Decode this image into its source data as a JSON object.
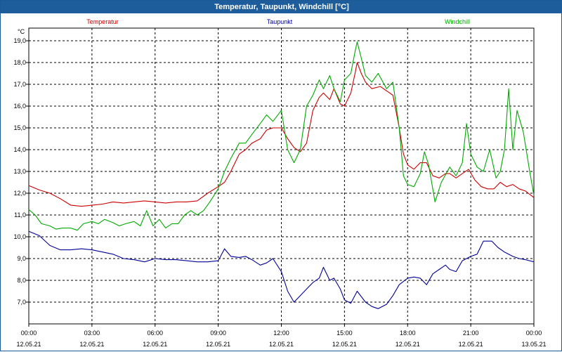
{
  "window": {
    "title": "Temperatur, Taupunkt, Windchill [°C]"
  },
  "chart_data": {
    "type": "line",
    "title": "Temperatur, Taupunkt, Windchill [°C]",
    "ylabel": "°C",
    "xlabel": "",
    "ylim": [
      6.2,
      19.5
    ],
    "xlim": [
      0,
      24
    ],
    "yticks": [
      7.0,
      8.0,
      9.0,
      10.0,
      11.0,
      12.0,
      13.0,
      14.0,
      15.0,
      16.0,
      17.0,
      18.0,
      19.0
    ],
    "ytick_labels": [
      "7,0",
      "8,0",
      "9,0",
      "10,0",
      "11,0",
      "12,0",
      "13,0",
      "14,0",
      "15,0",
      "16,0",
      "17,0",
      "18,0",
      "19,0"
    ],
    "xticks": [
      0,
      3,
      6,
      9,
      12,
      15,
      18,
      21,
      24
    ],
    "xtick_labels": [
      {
        "time": "00:00",
        "date": "12.05.21"
      },
      {
        "time": "03:00",
        "date": "12.05.21"
      },
      {
        "time": "06:00",
        "date": "12.05.21"
      },
      {
        "time": "09:00",
        "date": "12.05.21"
      },
      {
        "time": "12:00",
        "date": "12.05.21"
      },
      {
        "time": "15:00",
        "date": "12.05.21"
      },
      {
        "time": "18:00",
        "date": "12.05.21"
      },
      {
        "time": "21:00",
        "date": "12.05.21"
      },
      {
        "time": "00:00",
        "date": "13.05.21"
      }
    ],
    "grid": true,
    "legend_position": "top",
    "series": [
      {
        "name": "Temperatur",
        "color": "#cc0000",
        "points": [
          [
            0,
            12.35
          ],
          [
            0.5,
            12.15
          ],
          [
            1,
            12.0
          ],
          [
            1.5,
            11.75
          ],
          [
            2,
            11.45
          ],
          [
            2.5,
            11.4
          ],
          [
            3,
            11.45
          ],
          [
            3.5,
            11.5
          ],
          [
            4,
            11.6
          ],
          [
            4.5,
            11.55
          ],
          [
            5,
            11.6
          ],
          [
            5.5,
            11.65
          ],
          [
            6,
            11.6
          ],
          [
            6.5,
            11.55
          ],
          [
            7,
            11.6
          ],
          [
            7.5,
            11.6
          ],
          [
            8,
            11.65
          ],
          [
            8.5,
            12.0
          ],
          [
            9,
            12.3
          ],
          [
            9.3,
            12.5
          ],
          [
            9.6,
            13.0
          ],
          [
            10,
            13.8
          ],
          [
            10.3,
            14.0
          ],
          [
            10.6,
            14.3
          ],
          [
            11,
            14.5
          ],
          [
            11.3,
            14.9
          ],
          [
            11.6,
            15.0
          ],
          [
            12,
            15.0
          ],
          [
            12.3,
            14.5
          ],
          [
            12.6,
            14.1
          ],
          [
            12.9,
            13.9
          ],
          [
            13.2,
            14.3
          ],
          [
            13.5,
            15.8
          ],
          [
            13.8,
            16.4
          ],
          [
            14,
            16.6
          ],
          [
            14.3,
            16.3
          ],
          [
            14.5,
            16.8
          ],
          [
            14.8,
            16.1
          ],
          [
            15,
            16.0
          ],
          [
            15.3,
            16.6
          ],
          [
            15.5,
            17.5
          ],
          [
            15.6,
            18.0
          ],
          [
            15.8,
            17.5
          ],
          [
            16,
            17.1
          ],
          [
            16.3,
            16.8
          ],
          [
            16.7,
            16.9
          ],
          [
            17,
            16.7
          ],
          [
            17.3,
            16.5
          ],
          [
            17.6,
            15.0
          ],
          [
            17.8,
            13.8
          ],
          [
            18,
            13.3
          ],
          [
            18.3,
            13.1
          ],
          [
            18.6,
            13.4
          ],
          [
            18.9,
            13.4
          ],
          [
            19.2,
            12.8
          ],
          [
            19.5,
            12.7
          ],
          [
            19.8,
            12.9
          ],
          [
            20,
            12.9
          ],
          [
            20.3,
            12.7
          ],
          [
            20.6,
            12.9
          ],
          [
            20.9,
            13.1
          ],
          [
            21.2,
            12.6
          ],
          [
            21.5,
            12.3
          ],
          [
            21.8,
            12.2
          ],
          [
            22.1,
            12.2
          ],
          [
            22.4,
            12.5
          ],
          [
            22.7,
            12.3
          ],
          [
            23,
            12.4
          ],
          [
            23.3,
            12.2
          ],
          [
            23.6,
            12.1
          ],
          [
            24,
            11.8
          ]
        ]
      },
      {
        "name": "Taupunkt",
        "color": "#000099",
        "points": [
          [
            0,
            10.25
          ],
          [
            0.5,
            10.05
          ],
          [
            1,
            9.6
          ],
          [
            1.5,
            9.4
          ],
          [
            2,
            9.4
          ],
          [
            2.5,
            9.45
          ],
          [
            3,
            9.4
          ],
          [
            3.5,
            9.3
          ],
          [
            4,
            9.2
          ],
          [
            4.5,
            9.0
          ],
          [
            5,
            8.95
          ],
          [
            5.5,
            8.85
          ],
          [
            6,
            9.0
          ],
          [
            6.5,
            8.95
          ],
          [
            7,
            8.95
          ],
          [
            7.5,
            8.9
          ],
          [
            8,
            8.85
          ],
          [
            8.5,
            8.85
          ],
          [
            9,
            8.9
          ],
          [
            9.3,
            9.45
          ],
          [
            9.6,
            9.1
          ],
          [
            10,
            9.05
          ],
          [
            10.3,
            9.1
          ],
          [
            10.6,
            8.95
          ],
          [
            11,
            8.7
          ],
          [
            11.3,
            8.8
          ],
          [
            11.6,
            9.0
          ],
          [
            12,
            8.4
          ],
          [
            12.3,
            7.5
          ],
          [
            12.6,
            7.0
          ],
          [
            12.9,
            7.3
          ],
          [
            13.2,
            7.6
          ],
          [
            13.5,
            7.9
          ],
          [
            13.8,
            8.1
          ],
          [
            14,
            8.6
          ],
          [
            14.3,
            8.0
          ],
          [
            14.5,
            8.1
          ],
          [
            14.8,
            7.6
          ],
          [
            15,
            7.1
          ],
          [
            15.3,
            6.95
          ],
          [
            15.6,
            7.5
          ],
          [
            16,
            7.0
          ],
          [
            16.3,
            6.8
          ],
          [
            16.6,
            6.7
          ],
          [
            17,
            6.9
          ],
          [
            17.3,
            7.3
          ],
          [
            17.6,
            7.8
          ],
          [
            18,
            8.1
          ],
          [
            18.3,
            8.15
          ],
          [
            18.6,
            8.1
          ],
          [
            18.9,
            7.8
          ],
          [
            19.2,
            8.3
          ],
          [
            19.5,
            8.5
          ],
          [
            19.8,
            8.7
          ],
          [
            20,
            8.5
          ],
          [
            20.3,
            8.4
          ],
          [
            20.6,
            8.9
          ],
          [
            21,
            9.1
          ],
          [
            21.3,
            9.2
          ],
          [
            21.6,
            9.8
          ],
          [
            22,
            9.8
          ],
          [
            22.3,
            9.5
          ],
          [
            22.6,
            9.3
          ],
          [
            23,
            9.1
          ],
          [
            23.3,
            9.0
          ],
          [
            23.6,
            8.95
          ],
          [
            24,
            8.85
          ]
        ]
      },
      {
        "name": "Windchill",
        "color": "#00aa00",
        "points": [
          [
            0,
            11.25
          ],
          [
            0.3,
            11.0
          ],
          [
            0.6,
            10.6
          ],
          [
            1,
            10.5
          ],
          [
            1.3,
            10.35
          ],
          [
            1.6,
            10.4
          ],
          [
            2,
            10.4
          ],
          [
            2.3,
            10.3
          ],
          [
            2.6,
            10.6
          ],
          [
            3,
            10.7
          ],
          [
            3.3,
            10.6
          ],
          [
            3.6,
            10.8
          ],
          [
            4,
            10.65
          ],
          [
            4.3,
            10.5
          ],
          [
            4.6,
            10.6
          ],
          [
            5,
            10.7
          ],
          [
            5.3,
            10.5
          ],
          [
            5.6,
            11.2
          ],
          [
            5.9,
            10.5
          ],
          [
            6.2,
            10.8
          ],
          [
            6.5,
            10.4
          ],
          [
            6.8,
            10.6
          ],
          [
            7.1,
            10.6
          ],
          [
            7.4,
            11.0
          ],
          [
            7.7,
            11.2
          ],
          [
            8,
            11.0
          ],
          [
            8.3,
            11.2
          ],
          [
            8.6,
            11.6
          ],
          [
            9,
            12.2
          ],
          [
            9.3,
            13.0
          ],
          [
            9.6,
            13.6
          ],
          [
            10,
            14.3
          ],
          [
            10.3,
            14.3
          ],
          [
            10.6,
            14.7
          ],
          [
            11,
            15.2
          ],
          [
            11.3,
            15.6
          ],
          [
            11.6,
            15.3
          ],
          [
            12,
            15.8
          ],
          [
            12.3,
            14.0
          ],
          [
            12.6,
            13.4
          ],
          [
            12.9,
            14.0
          ],
          [
            13.2,
            16.0
          ],
          [
            13.5,
            16.5
          ],
          [
            13.8,
            17.2
          ],
          [
            14,
            16.8
          ],
          [
            14.3,
            17.4
          ],
          [
            14.5,
            16.8
          ],
          [
            14.8,
            16.2
          ],
          [
            15,
            17.2
          ],
          [
            15.3,
            17.5
          ],
          [
            15.5,
            18.5
          ],
          [
            15.6,
            18.95
          ],
          [
            15.8,
            18.2
          ],
          [
            16,
            17.4
          ],
          [
            16.3,
            17.1
          ],
          [
            16.6,
            17.5
          ],
          [
            17,
            16.8
          ],
          [
            17.3,
            17.1
          ],
          [
            17.6,
            15.0
          ],
          [
            17.8,
            12.8
          ],
          [
            18,
            12.4
          ],
          [
            18.3,
            12.3
          ],
          [
            18.6,
            12.9
          ],
          [
            18.8,
            13.9
          ],
          [
            19,
            13.3
          ],
          [
            19.3,
            11.6
          ],
          [
            19.6,
            12.5
          ],
          [
            20,
            13.2
          ],
          [
            20.3,
            12.8
          ],
          [
            20.6,
            13.4
          ],
          [
            20.8,
            15.2
          ],
          [
            21.0,
            13.8
          ],
          [
            21.3,
            13.2
          ],
          [
            21.6,
            13.0
          ],
          [
            21.9,
            14.0
          ],
          [
            22.2,
            12.7
          ],
          [
            22.4,
            13.0
          ],
          [
            22.6,
            14.0
          ],
          [
            22.8,
            16.8
          ],
          [
            23.0,
            14.0
          ],
          [
            23.2,
            15.8
          ],
          [
            23.5,
            14.8
          ],
          [
            23.8,
            13.0
          ],
          [
            24,
            11.9
          ]
        ]
      }
    ]
  }
}
